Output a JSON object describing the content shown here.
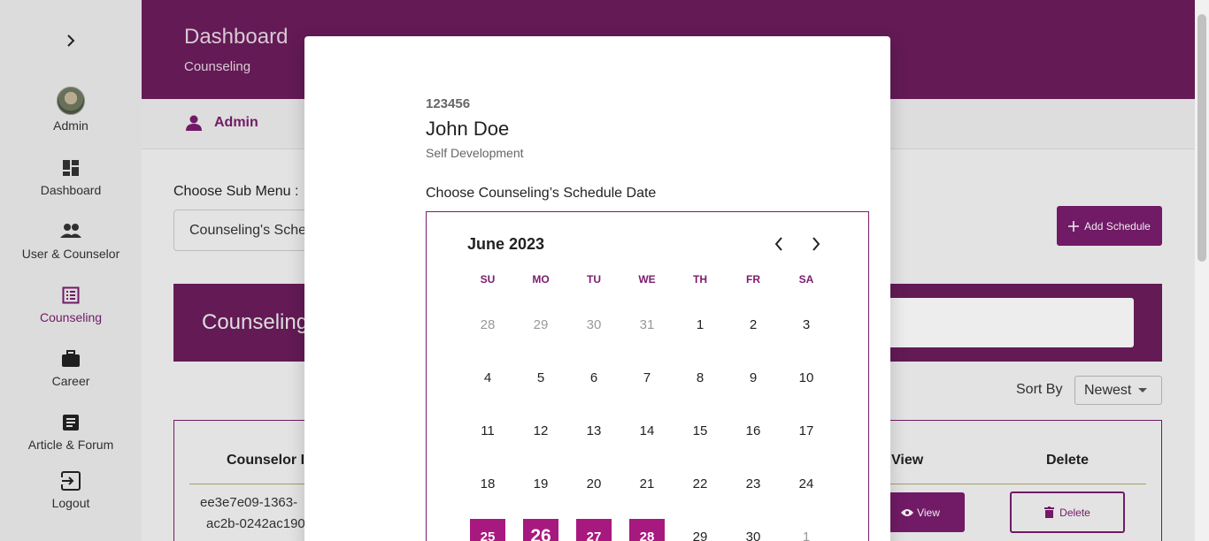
{
  "sidebar": {
    "items": [
      {
        "label": "Admin"
      },
      {
        "label": "Dashboard"
      },
      {
        "label": "User & Counselor"
      },
      {
        "label": "Counseling"
      },
      {
        "label": "Career"
      },
      {
        "label": "Article & Forum"
      },
      {
        "label": "Logout"
      }
    ],
    "active_color": "#7a1c6e"
  },
  "header": {
    "title": "Dashboard",
    "subtitle": "Counseling"
  },
  "userbar": {
    "user": "Admin"
  },
  "content": {
    "submenu_label": "Choose Sub Menu :",
    "submenu_value": "Counseling's Schedule",
    "add_button": "Add Schedule",
    "banner_title": "Counseling",
    "sort_label": "Sort By",
    "sort_value": "Newest"
  },
  "table": {
    "headers": [
      "Counselor Id",
      "View",
      "Delete"
    ],
    "row": {
      "id_line1": "ee3e7e09-1363-",
      "id_line2": "ac2b-0242ac190",
      "view": "View",
      "delete": "Delete"
    }
  },
  "modal": {
    "counselor_id": "123456",
    "name": "John Doe",
    "category": "Self Development",
    "label": "Choose Counseling’s Schedule Date",
    "calendar": {
      "month": "June 2023",
      "weekdays": [
        "SU",
        "MO",
        "TU",
        "WE",
        "TH",
        "FR",
        "SA"
      ],
      "weeks": [
        [
          "28",
          "29",
          "30",
          "31",
          "1",
          "2",
          "3"
        ],
        [
          "4",
          "5",
          "6",
          "7",
          "8",
          "9",
          "10"
        ],
        [
          "11",
          "12",
          "13",
          "14",
          "15",
          "16",
          "17"
        ],
        [
          "18",
          "19",
          "20",
          "21",
          "22",
          "23",
          "24"
        ],
        [
          "25",
          "26",
          "27",
          "28",
          "29",
          "30",
          "1"
        ]
      ],
      "selected": [
        "25",
        "26",
        "27",
        "28"
      ],
      "accent": "#a8197f"
    }
  },
  "colors": {
    "brand": "#6b1d5c",
    "accent": "#7a1c6e"
  }
}
